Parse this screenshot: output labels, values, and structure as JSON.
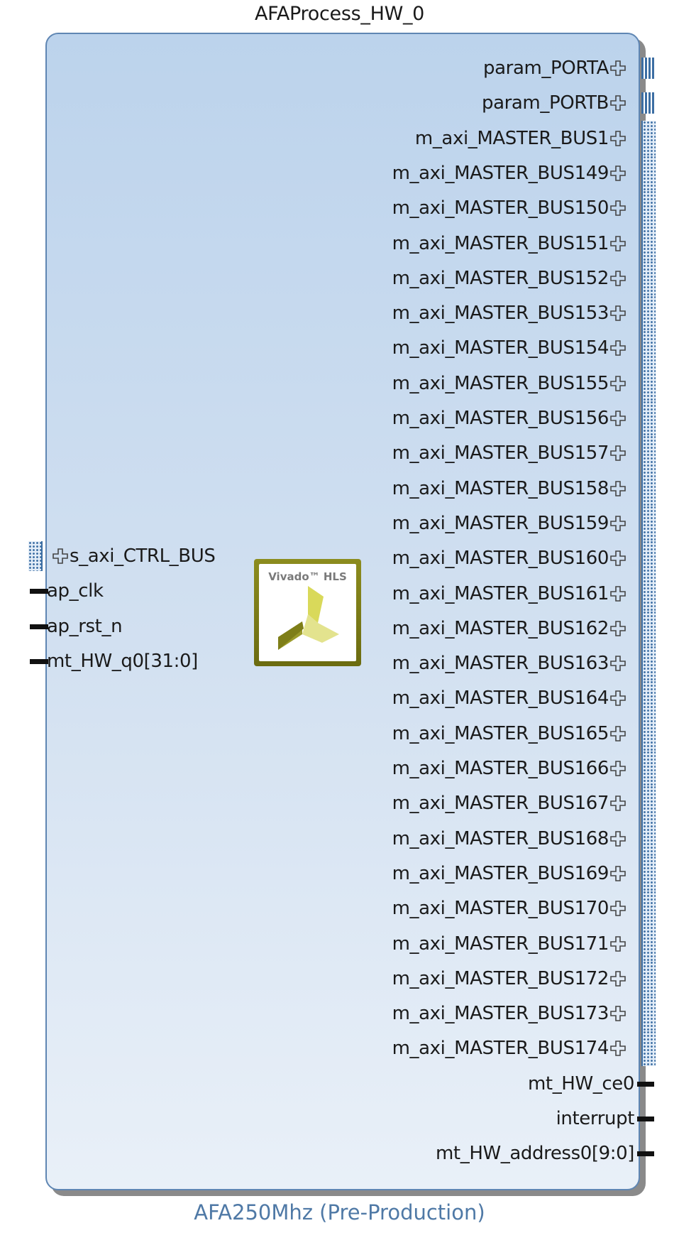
{
  "block": {
    "instance_name": "AFAProcess_HW_0",
    "part_label": "AFA250Mhz (Pre-Production)",
    "logo_text": "Vivado™ HLS"
  },
  "right_bus_ports": [
    {
      "name": "param_PORTA",
      "style": "solid"
    },
    {
      "name": "param_PORTB",
      "style": "solid"
    },
    {
      "name": "m_axi_MASTER_BUS1",
      "style": "dotted"
    },
    {
      "name": "m_axi_MASTER_BUS149",
      "style": "dotted"
    },
    {
      "name": "m_axi_MASTER_BUS150",
      "style": "dotted"
    },
    {
      "name": "m_axi_MASTER_BUS151",
      "style": "dotted"
    },
    {
      "name": "m_axi_MASTER_BUS152",
      "style": "dotted"
    },
    {
      "name": "m_axi_MASTER_BUS153",
      "style": "dotted"
    },
    {
      "name": "m_axi_MASTER_BUS154",
      "style": "dotted"
    },
    {
      "name": "m_axi_MASTER_BUS155",
      "style": "dotted"
    },
    {
      "name": "m_axi_MASTER_BUS156",
      "style": "dotted"
    },
    {
      "name": "m_axi_MASTER_BUS157",
      "style": "dotted"
    },
    {
      "name": "m_axi_MASTER_BUS158",
      "style": "dotted"
    },
    {
      "name": "m_axi_MASTER_BUS159",
      "style": "dotted"
    },
    {
      "name": "m_axi_MASTER_BUS160",
      "style": "dotted"
    },
    {
      "name": "m_axi_MASTER_BUS161",
      "style": "dotted"
    },
    {
      "name": "m_axi_MASTER_BUS162",
      "style": "dotted"
    },
    {
      "name": "m_axi_MASTER_BUS163",
      "style": "dotted"
    },
    {
      "name": "m_axi_MASTER_BUS164",
      "style": "dotted"
    },
    {
      "name": "m_axi_MASTER_BUS165",
      "style": "dotted"
    },
    {
      "name": "m_axi_MASTER_BUS166",
      "style": "dotted"
    },
    {
      "name": "m_axi_MASTER_BUS167",
      "style": "dotted"
    },
    {
      "name": "m_axi_MASTER_BUS168",
      "style": "dotted"
    },
    {
      "name": "m_axi_MASTER_BUS169",
      "style": "dotted"
    },
    {
      "name": "m_axi_MASTER_BUS170",
      "style": "dotted"
    },
    {
      "name": "m_axi_MASTER_BUS171",
      "style": "dotted"
    },
    {
      "name": "m_axi_MASTER_BUS172",
      "style": "dotted"
    },
    {
      "name": "m_axi_MASTER_BUS173",
      "style": "dotted"
    },
    {
      "name": "m_axi_MASTER_BUS174",
      "style": "dotted"
    }
  ],
  "right_signal_ports": [
    {
      "name": "mt_HW_ce0"
    },
    {
      "name": "interrupt"
    },
    {
      "name": "mt_HW_address0[9:0]"
    }
  ],
  "left_ports": [
    {
      "name": "s_axi_CTRL_BUS",
      "kind": "bus"
    },
    {
      "name": "ap_clk",
      "kind": "signal"
    },
    {
      "name": "ap_rst_n",
      "kind": "signal"
    },
    {
      "name": "mt_HW_q0[31:0]",
      "kind": "signal"
    }
  ],
  "colors": {
    "block_border": "#5f86b3",
    "bus_pin": "#3c6ea3",
    "subtitle": "#4f79a6",
    "logo_frame": "#7a7a14"
  }
}
